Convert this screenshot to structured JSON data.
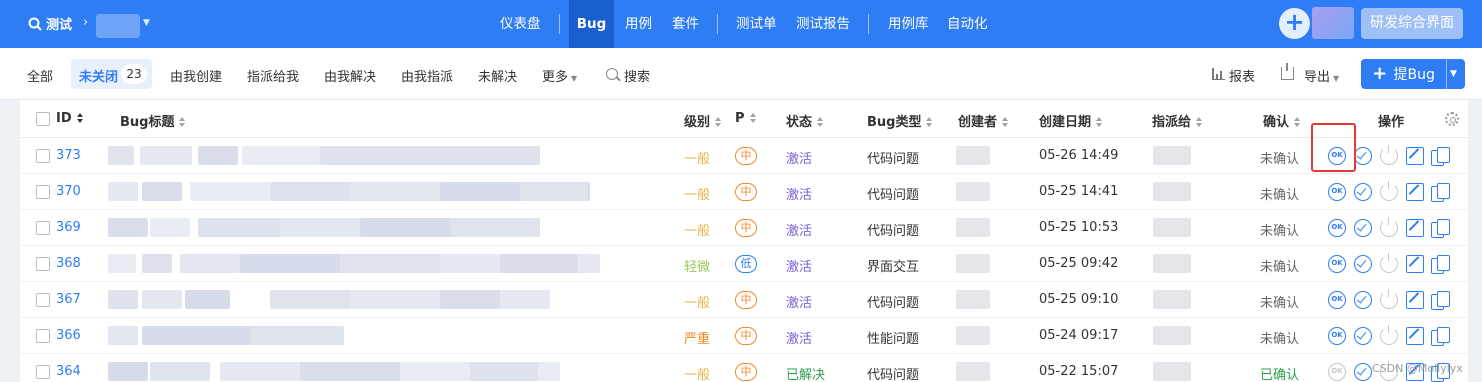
{
  "topbar": {
    "app_name": "测试",
    "nav": [
      "仪表盘",
      "Bug",
      "用例",
      "套件",
      "测试单",
      "测试报告",
      "用例库",
      "自动化"
    ],
    "active_nav": "Bug",
    "workspace_button": "研发综合界面"
  },
  "filters": {
    "items": [
      "全部",
      "未关闭",
      "由我创建",
      "指派给我",
      "由我解决",
      "由我指派",
      "未解决",
      "更多",
      "搜索"
    ],
    "active": "未关闭",
    "active_count": "23",
    "report_label": "报表",
    "export_label": "导出",
    "create_bug_label": "提Bug"
  },
  "table": {
    "headers": {
      "id": "ID",
      "title": "Bug标题",
      "severity": "级别",
      "priority": "P",
      "status": "状态",
      "type": "Bug类型",
      "creator": "创建者",
      "created_date": "创建日期",
      "assignee": "指派给",
      "confirmed": "确认",
      "actions": "操作"
    },
    "rows": [
      {
        "id": "373",
        "severity": "一般",
        "priority": "中",
        "status": "激活",
        "type": "代码问题",
        "created": "05-26 14:49",
        "confirmed": "未确认"
      },
      {
        "id": "370",
        "severity": "一般",
        "priority": "中",
        "status": "激活",
        "type": "代码问题",
        "created": "05-25 14:41",
        "confirmed": "未确认"
      },
      {
        "id": "369",
        "severity": "一般",
        "priority": "中",
        "status": "激活",
        "type": "代码问题",
        "created": "05-25 10:53",
        "confirmed": "未确认"
      },
      {
        "id": "368",
        "severity": "轻微",
        "priority": "低",
        "status": "激活",
        "type": "界面交互",
        "created": "05-25 09:42",
        "confirmed": "未确认"
      },
      {
        "id": "367",
        "severity": "一般",
        "priority": "中",
        "status": "激活",
        "type": "代码问题",
        "created": "05-25 09:10",
        "confirmed": "未确认"
      },
      {
        "id": "366",
        "severity": "严重",
        "priority": "中",
        "status": "激活",
        "type": "性能问题",
        "created": "05-24 09:17",
        "confirmed": "未确认"
      },
      {
        "id": "364",
        "severity": "一般",
        "priority": "中",
        "status": "已解决",
        "type": "代码问题",
        "created": "05-22 15:07",
        "confirmed": "已确认"
      }
    ]
  },
  "watermark": "CSDN @Mollylyx",
  "colors": {
    "primary": "#2f7df4",
    "severity_normal": "#e6b34d",
    "severity_minor": "#9cc65a",
    "severity_severe": "#f08a24",
    "priority_mid": "#f08a24",
    "priority_low": "#2f7df4",
    "status_active": "#7b61d6",
    "status_resolved": "#2e9e4f",
    "highlight_box": "#e53935"
  }
}
